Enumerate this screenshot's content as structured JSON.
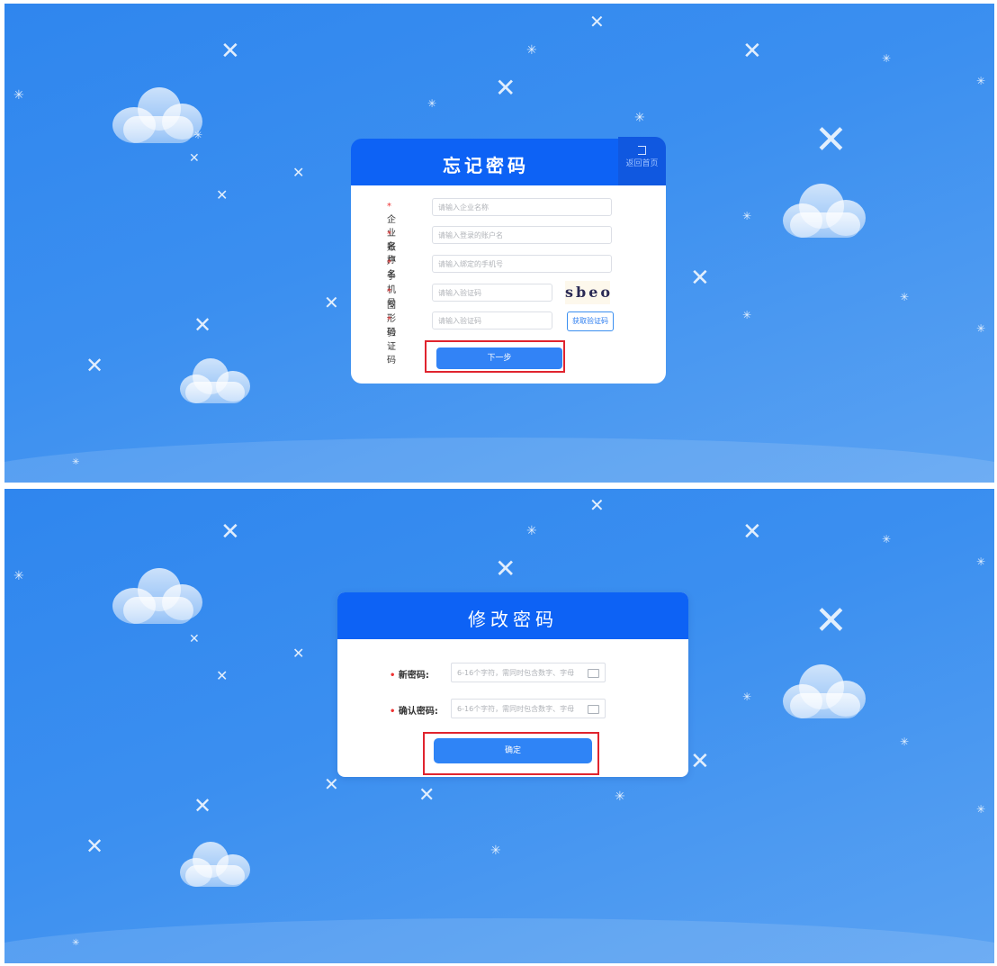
{
  "forgot": {
    "title": "忘记密码",
    "back_label": "返回首页",
    "fields": [
      {
        "required": "*",
        "label": "企业名称",
        "placeholder": "请输入企业名称"
      },
      {
        "required": "*",
        "label": "账户名",
        "placeholder": "请输入登录的账户名"
      },
      {
        "required": "*",
        "label": "手机号",
        "placeholder": "请输入绑定的手机号"
      },
      {
        "required": "*",
        "label": "图形码",
        "placeholder": "请输入验证码"
      },
      {
        "required": "*",
        "label": "验证码",
        "placeholder": "请输入验证码"
      }
    ],
    "captcha_text": "sbeo",
    "get_code_label": "获取验证码",
    "next_label": "下一步"
  },
  "change": {
    "title": "修改密码",
    "fields": [
      {
        "required": "•",
        "label": "新密码:",
        "placeholder": "6-16个字符，需同时包含数字、字母"
      },
      {
        "required": "•",
        "label": "确认密码:",
        "placeholder": "6-16个字符，需同时包含数字、字母"
      }
    ],
    "confirm_label": "确定"
  },
  "colors": {
    "background": "#3b8ff0",
    "header": "#0d62f5",
    "button": "#3283f6",
    "highlight": "#e0242e",
    "required": "#e33333"
  }
}
